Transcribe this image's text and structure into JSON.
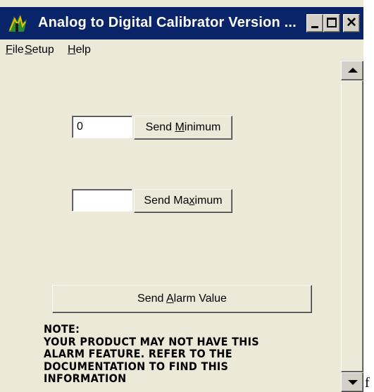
{
  "window": {
    "title": "Analog to Digital Calibrator Version ...",
    "icon": "app-icon"
  },
  "menu": {
    "file": {
      "mnemonic": "F",
      "rest": "ile"
    },
    "setup": {
      "mnemonic": "S",
      "rest": "etup"
    },
    "help": {
      "mnemonic": "H",
      "rest": "elp"
    }
  },
  "minimum": {
    "value": "0",
    "button": {
      "before": "Send ",
      "mnemonic": "M",
      "after": "inimum"
    }
  },
  "maximum": {
    "value": "",
    "button": {
      "before": "Send Ma",
      "mnemonic": "x",
      "after": "imum"
    }
  },
  "alarm": {
    "button": {
      "before": "Send ",
      "mnemonic": "A",
      "after": "larm Value"
    }
  },
  "note": {
    "lines": [
      "NOTE:",
      "YOUR PRODUCT MAY NOT HAVE THIS",
      "ALARM FEATURE. REFER TO THE",
      "DOCUMENTATION TO FIND THIS",
      "INFORMATION"
    ]
  },
  "stray_char": "f",
  "colors": {
    "titlebar": "#0a246a",
    "face": "#ece9d8"
  }
}
